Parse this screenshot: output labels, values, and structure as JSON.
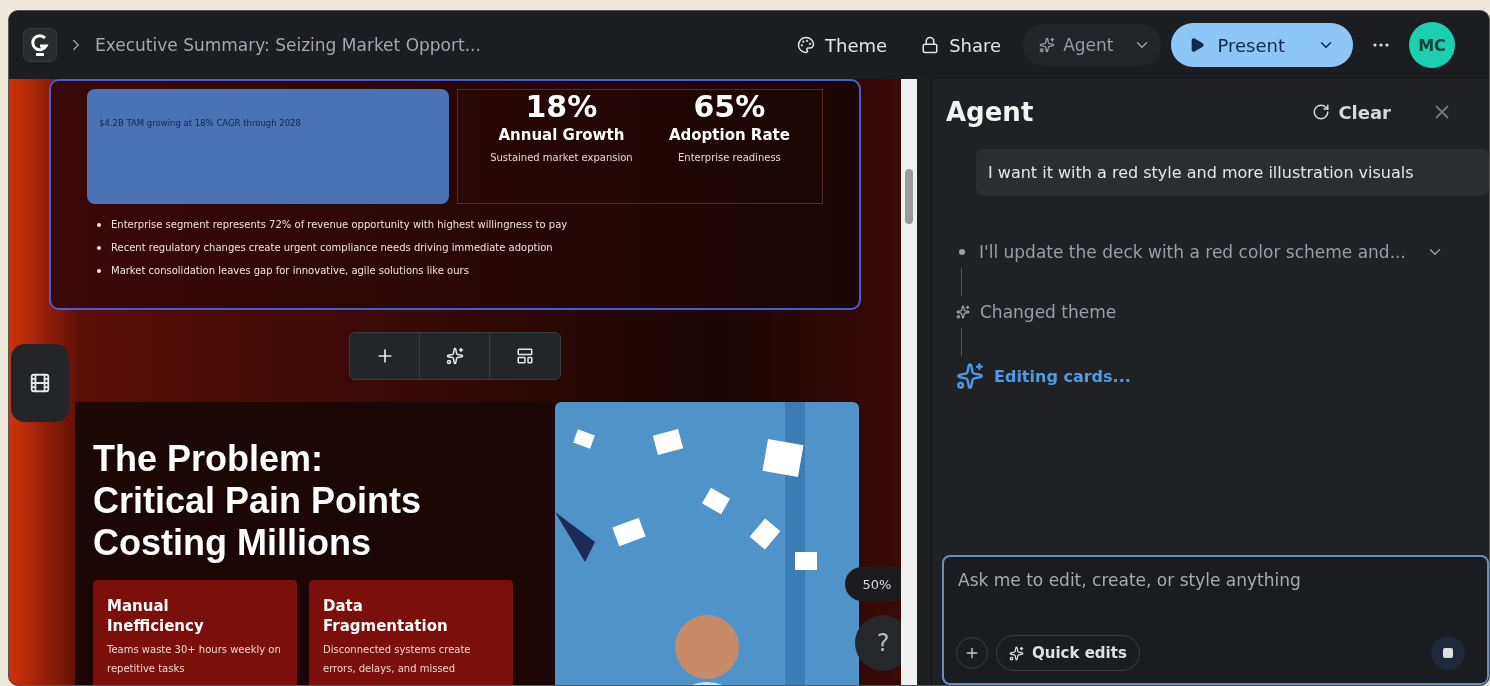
{
  "topbar": {
    "breadcrumb": "Executive Summary: Seizing Market Opport...",
    "buttons": [
      {
        "kind": "theme",
        "label": "Theme"
      },
      {
        "kind": "share",
        "label": "Share"
      }
    ],
    "agent_button": "Agent",
    "present_button": "Present",
    "avatar": "MC"
  },
  "slide_top": {
    "tam_text": "$4.2B TAM growing at 18% CAGR through 2028",
    "stats": [
      {
        "value": "18%",
        "label": "Annual Growth",
        "caption": "Sustained market expansion"
      },
      {
        "value": "65%",
        "label": "Adoption Rate",
        "caption": "Enterprise readiness"
      }
    ],
    "bullets": [
      "Enterprise segment represents 72% of revenue opportunity with highest willingness to pay",
      "Recent regulatory changes create urgent compliance needs driving immediate adoption",
      "Market consolidation leaves gap for innovative, agile solutions like ours"
    ]
  },
  "slide_bottom": {
    "title": "The Problem: Critical Pain Points Costing Millions",
    "cards": [
      {
        "title": "Manual Inefficiency",
        "text": "Teams waste 30+ hours weekly on repetitive tasks"
      },
      {
        "title": "Data Fragmentation",
        "text": "Disconnected systems create errors, delays, and missed"
      }
    ]
  },
  "zoom": "50%",
  "help": "?",
  "agent": {
    "title": "Agent",
    "clear": "Clear",
    "user_message": "I want it with a red style and more illustration visuals",
    "steps": [
      {
        "kind": "message",
        "text": "I'll update the deck with a red color scheme and..."
      },
      {
        "kind": "action",
        "text": "Changed theme"
      },
      {
        "kind": "progress",
        "text": "Editing cards..."
      }
    ],
    "input": {
      "placeholder": "Ask me to edit, create, or style anything"
    },
    "quick_edits": "Quick edits"
  }
}
